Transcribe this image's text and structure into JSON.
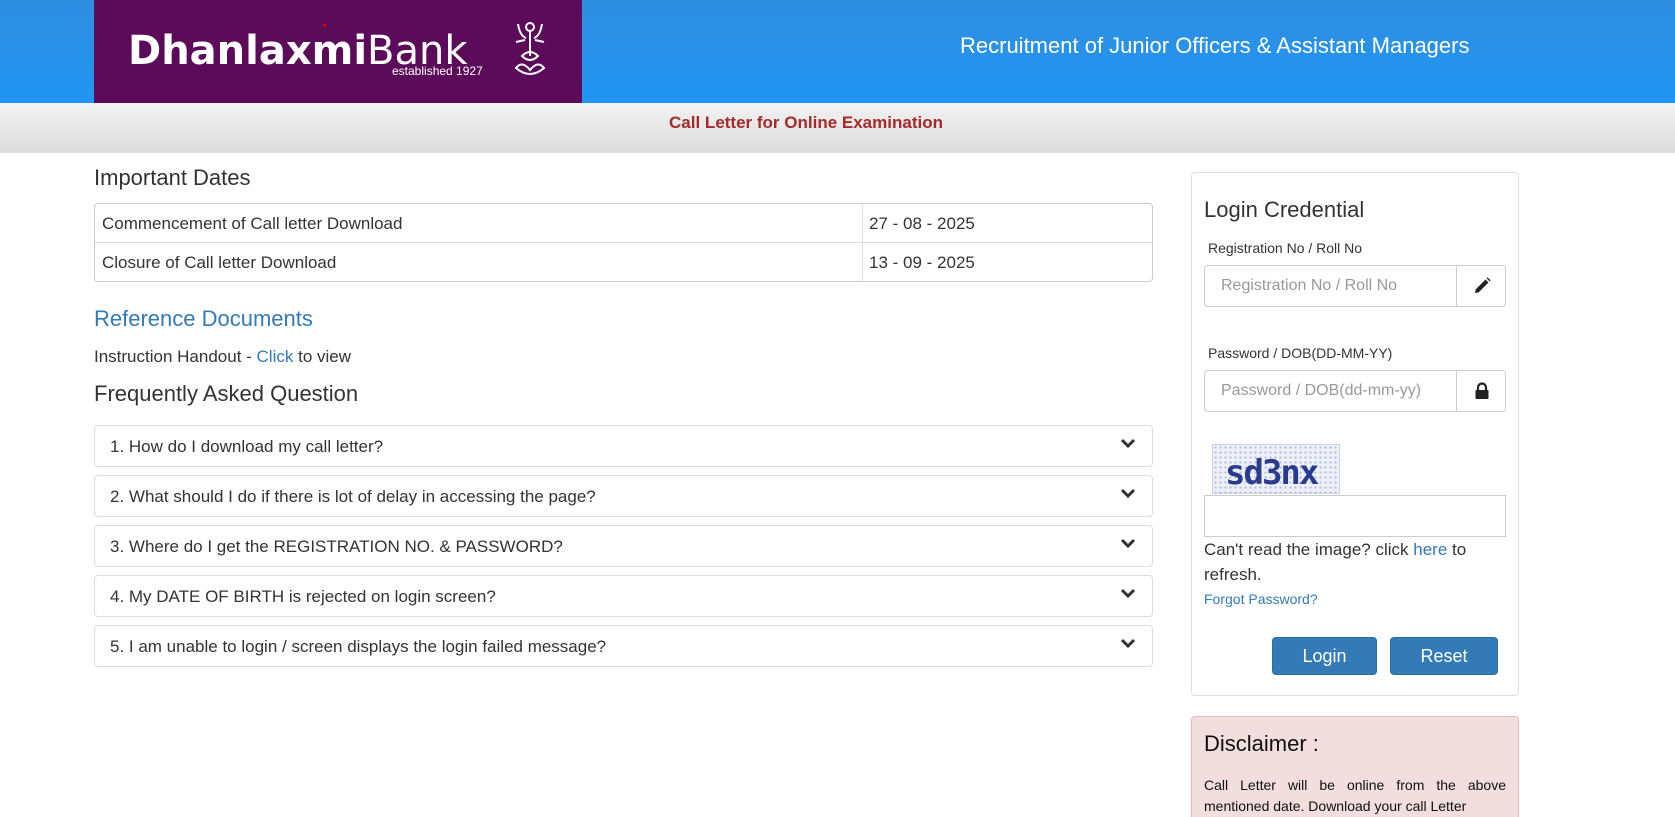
{
  "header": {
    "brand_bold": "Dhanlaxmi",
    "brand_light": "Bank",
    "established": "established 1927",
    "title": "Recruitment of Junior Officers & Assistant Managers"
  },
  "subbar": {
    "title": "Call Letter for Online Examination"
  },
  "important_dates": {
    "heading": "Important Dates",
    "rows": [
      {
        "label": "Commencement of Call letter Download",
        "value": "27 - 08 - 2025"
      },
      {
        "label": "Closure of Call letter Download",
        "value": "13 - 09 - 2025"
      }
    ]
  },
  "reference": {
    "heading": "Reference Documents",
    "handout_prefix": "Instruction Handout - ",
    "handout_link": "Click",
    "handout_suffix": " to view"
  },
  "faq": {
    "heading": "Frequently Asked Question",
    "items": [
      "1. How do I download my call letter?",
      "2. What should I do if there is lot of delay in accessing the page?",
      "3. Where do I get the REGISTRATION NO. & PASSWORD?",
      "4. My DATE OF BIRTH is rejected on login screen?",
      "5. I am unable to login / screen displays the login failed message?"
    ]
  },
  "login": {
    "title": "Login Credential",
    "reg_label": "Registration No / Roll No",
    "reg_placeholder": "Registration No / Roll No",
    "reg_icon": "pencil-icon",
    "pwd_label": "Password / DOB(DD-MM-YY)",
    "pwd_placeholder": "Password / DOB(dd-mm-yy)",
    "pwd_icon": "lock-icon",
    "captcha_text": "sd3nx",
    "captcha_value": "",
    "cant_read_prefix": "Can't read the image? click ",
    "cant_read_link": "here",
    "cant_read_suffix": " to refresh.",
    "forgot": "Forgot Password?",
    "login_button": "Login",
    "reset_button": "Reset"
  },
  "disclaimer": {
    "title": "Disclaimer :",
    "text": "Call Letter will be online from the above mentioned date. Download your call Letter"
  },
  "colors": {
    "header_blue": "#2196f3",
    "logo_purple": "#5c0b5a",
    "subbar_title": "#a52a2a",
    "link_blue": "#337ab7",
    "button_blue": "#337ab7",
    "disclaimer_bg": "#f2dede"
  }
}
